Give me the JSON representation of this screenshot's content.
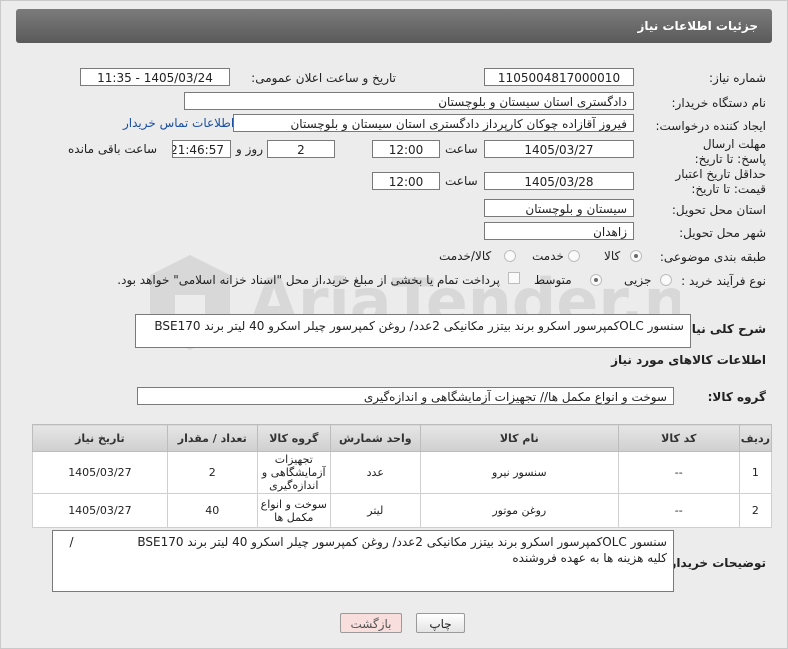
{
  "header": {
    "title": "جزئیات اطلاعات نیاز"
  },
  "fields": {
    "need_number": {
      "label": "شماره نیاز:",
      "value": "1105004817000010"
    },
    "announce_datetime": {
      "label": "تاریخ و ساعت اعلان عمومی:",
      "value": "1405/03/24 - 11:35"
    },
    "buyer_org": {
      "label": "نام دستگاه خریدار:",
      "value": "دادگستری استان سیستان و بلوچستان"
    },
    "requester": {
      "label": "ایجاد کننده درخواست:",
      "value": "فیروز آقازاده چوکان کارپرداز دادگستری استان سیستان و بلوچستان",
      "contact_link": "اطلاعات تماس خریدار"
    },
    "reply_deadline": {
      "label": "مهلت ارسال پاسخ: تا تاریخ:",
      "date": "1405/03/27",
      "time_label": "ساعت",
      "time": "12:00",
      "days": "2",
      "days_label": "روز و",
      "remaining": "21:46:57",
      "remaining_label": "ساعت باقی مانده"
    },
    "price_validity": {
      "label": "حداقل تاریخ اعتبار قیمت: تا تاریخ:",
      "date": "1405/03/28",
      "time_label": "ساعت",
      "time": "12:00"
    },
    "delivery_province": {
      "label": "استان محل تحویل:",
      "value": "سیستان و بلوچستان"
    },
    "delivery_city": {
      "label": "شهر محل تحویل:",
      "value": "زاهدان"
    },
    "category": {
      "label": "طبقه بندی موضوعی:",
      "options": [
        "کالا",
        "خدمت",
        "کالا/خدمت"
      ],
      "selected": "کالا"
    },
    "purchase_type": {
      "label": "نوع فرآیند خرید :",
      "options": [
        "جزیی",
        "متوسط"
      ],
      "selected": "متوسط",
      "checkbox_text": "پرداخت تمام یا بخشی از مبلغ خرید،از محل \"اسناد خزانه اسلامی\" خواهد بود."
    }
  },
  "summary": {
    "label": "شرح کلی نیاز:",
    "value": "سنسور OLCکمپرسور اسکرو برند بیتزر مکانیکی  2عدد/ روغن کمپرسور چیلر اسکرو 40 لیتر برند BSE170"
  },
  "goods_section": {
    "title": "اطلاعات کالاهای مورد نیاز",
    "group_label": "گروه کالا:",
    "group_value": "سوخت و انواع مکمل ها// تجهیزات آزمایشگاهی و اندازه‌گیری"
  },
  "table": {
    "headers": [
      "ردیف",
      "کد کالا",
      "نام کالا",
      "واحد شمارش",
      "گروه کالا",
      "تعداد / مقدار",
      "تاریخ نیاز"
    ],
    "rows": [
      {
        "row": "1",
        "code": "--",
        "name": "سنسور نیرو",
        "unit": "عدد",
        "group": "تجهیزات آزمایشگاهی و اندازه‌گیری",
        "qty": "2",
        "date": "1405/03/27"
      },
      {
        "row": "2",
        "code": "--",
        "name": "روغن موتور",
        "unit": "لیتر",
        "group": "سوخت و انواع مکمل ها",
        "qty": "40",
        "date": "1405/03/27"
      }
    ]
  },
  "buyer_notes": {
    "label": "توضیحات خریدار:",
    "line1": "سنسور OLCکمپرسور اسکرو برند بیتزر مکانیکی  2عدد/ روغن کمپرسور چیلر اسکرو 40 لیتر برند  BSE170",
    "slash": "/",
    "line2": "کلیه هزینه ها به عهده فروشنده"
  },
  "buttons": {
    "print": "چاپ",
    "back": "بازگشت"
  },
  "watermark": {
    "text": "AriaTender.net"
  },
  "colors": {
    "titlebar": "#666666",
    "link": "#1a4fa0",
    "back_button_bg": "#f9dede"
  }
}
